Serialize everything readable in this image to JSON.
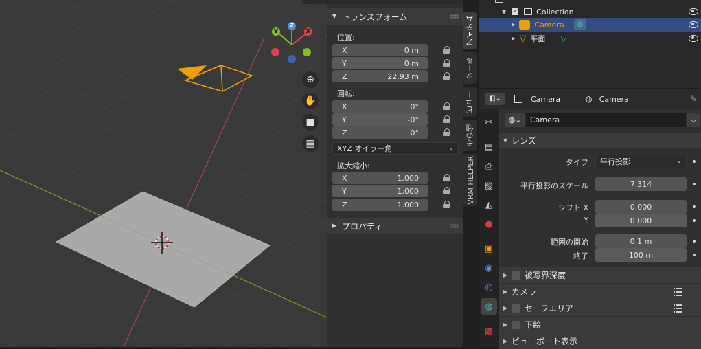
{
  "npanel": {
    "transform_title": "トランスフォーム",
    "location_label": "位置:",
    "location": [
      {
        "axis": "X",
        "value": "0 m"
      },
      {
        "axis": "Y",
        "value": "0 m"
      },
      {
        "axis": "Z",
        "value": "22.93 m"
      }
    ],
    "rotation_label": "回転:",
    "rotation": [
      {
        "axis": "X",
        "value": "0°"
      },
      {
        "axis": "Y",
        "value": "-0°"
      },
      {
        "axis": "Z",
        "value": "0°"
      }
    ],
    "rotation_mode": "XYZ オイラー角",
    "scale_label": "拡大縮小:",
    "scale": [
      {
        "axis": "X",
        "value": "1.000"
      },
      {
        "axis": "Y",
        "value": "1.000"
      },
      {
        "axis": "Z",
        "value": "1.000"
      }
    ],
    "properties_title": "プロパティ"
  },
  "vertical_tabs": [
    "アイテム",
    "ツール",
    "ビュー",
    "その他",
    "VRM HELPER"
  ],
  "outliner": {
    "collection": "Collection",
    "camera": "Camera",
    "plane": "平面"
  },
  "properties": {
    "header_object": "Camera",
    "header_data": "Camera",
    "datablock_name": "Camera",
    "lens_title": "レンズ",
    "type_label": "タイプ",
    "type_value": "平行投影",
    "ortho_scale_label": "平行投影のスケール",
    "ortho_scale_value": "7.314",
    "shift_x_label": "シフト X",
    "shift_x_value": "0.000",
    "shift_y_label": "Y",
    "shift_y_value": "0.000",
    "clip_start_label": "範囲の開始",
    "clip_start_value": "0.1 m",
    "clip_end_label": "終了",
    "clip_end_value": "100 m",
    "dof_label": "被写界深度",
    "camera_label": "カメラ",
    "safe_areas_label": "セーフエリア",
    "background_label": "下絵",
    "viewport_display_label": "ビューポート表示"
  },
  "gizmo": {
    "x": "X",
    "y": "Y",
    "z": "Z"
  },
  "colors": {
    "accent_blue": "#334d80",
    "camera_orange": "#f0a000",
    "camera_teal": "#40c0b0",
    "axis_red": "#e04050",
    "axis_green": "#80c020"
  }
}
